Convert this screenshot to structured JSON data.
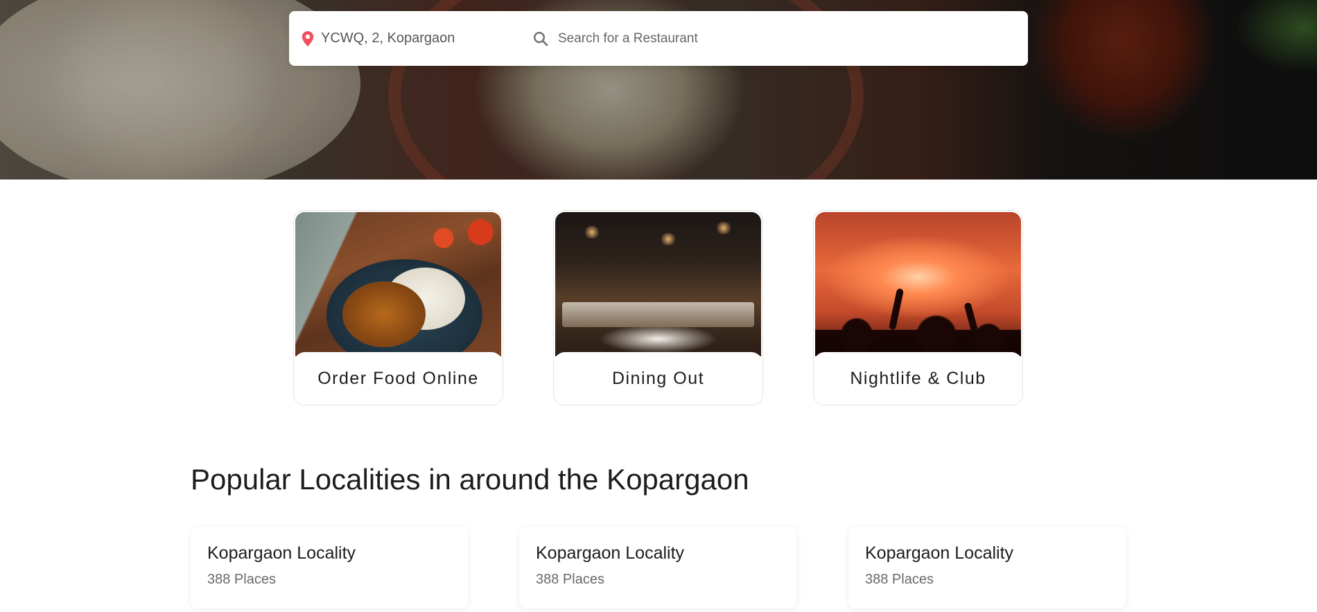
{
  "search": {
    "location_value": "YCWQ, 2, Kopargaon",
    "restaurant_placeholder": "Search for a Restaurant"
  },
  "categories": [
    {
      "label": "Order Food Online"
    },
    {
      "label": "Dining Out"
    },
    {
      "label": "Nightlife & Club"
    }
  ],
  "localities": {
    "title": "Popular Localities in around the Kopargaon",
    "items": [
      {
        "name": "Kopargaon Locality",
        "places": "388 Places"
      },
      {
        "name": "Kopargaon Locality",
        "places": "388 Places"
      },
      {
        "name": "Kopargaon Locality",
        "places": "388 Places"
      }
    ]
  },
  "colors": {
    "pin_icon": "#ef4f5f",
    "search_icon": "#777777",
    "text_primary": "#1c1c1c",
    "text_secondary": "#696969"
  },
  "icons": {
    "location": "location-pin-icon",
    "search": "search-icon"
  }
}
